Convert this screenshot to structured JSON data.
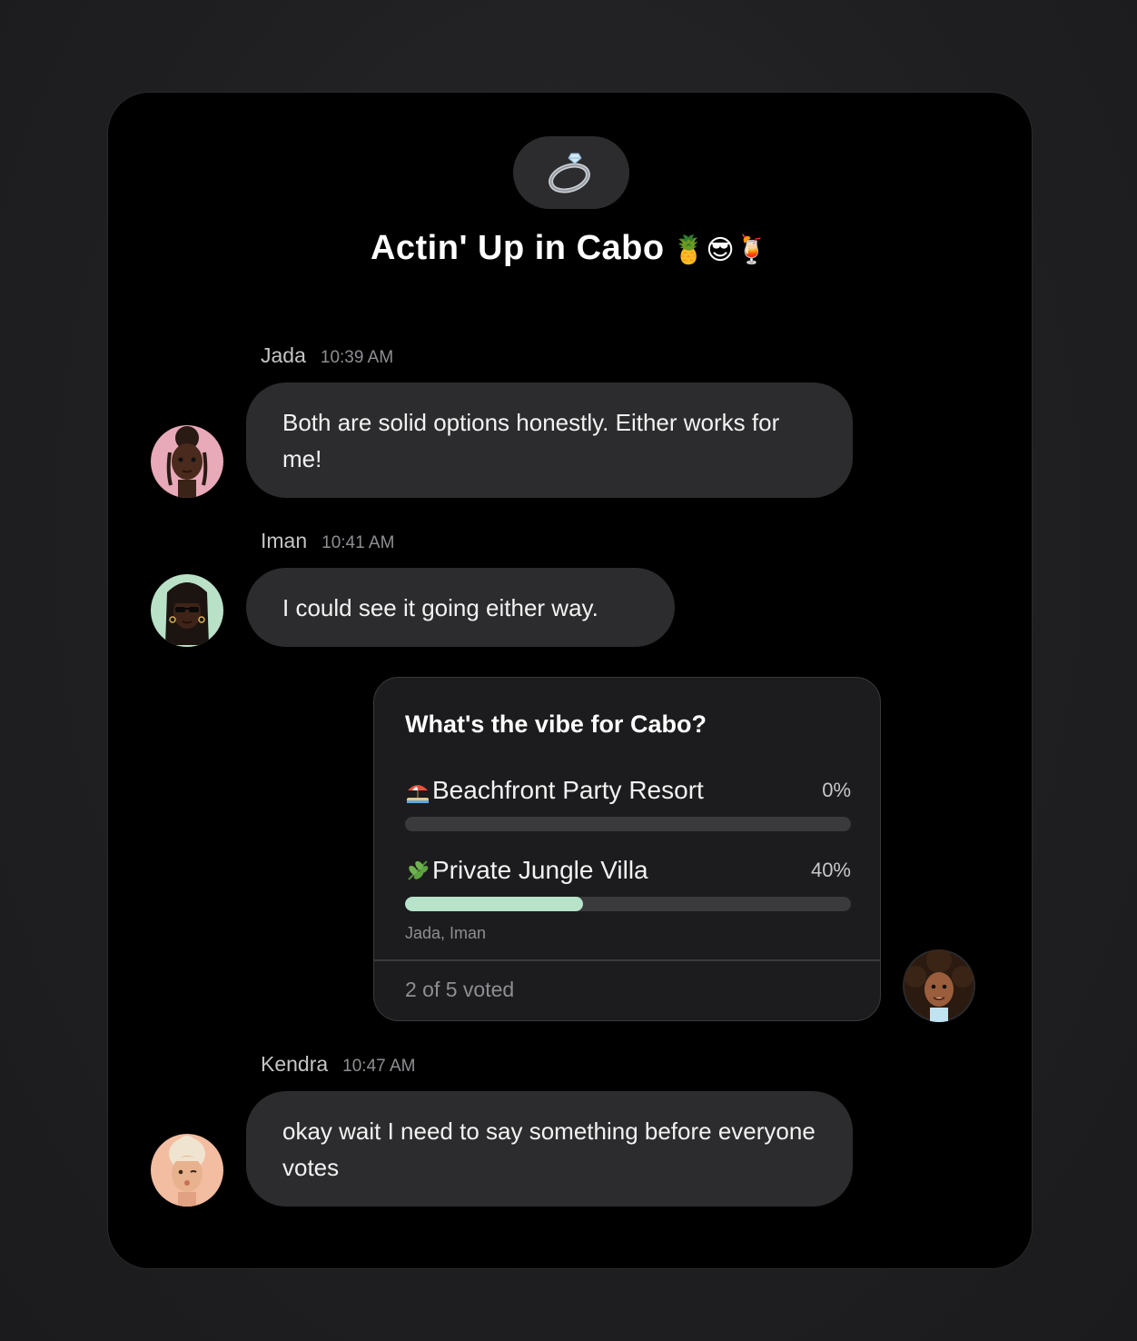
{
  "chat": {
    "group_icon": "ring-icon",
    "title": "Actin' Up in Cabo",
    "title_emojis": "🍍😎🍹"
  },
  "messages": [
    {
      "sender": "Jada",
      "time": "10:39 AM",
      "text": "Both are solid options honestly. Either works for me!",
      "avatar_color": "#e8a9b8"
    },
    {
      "sender": "Iman",
      "time": "10:41 AM",
      "text": "I could see it going either way.",
      "avatar_color": "#b9e1c8"
    },
    {
      "sender": "Kendra",
      "time": "10:47 AM",
      "text": "okay wait I need to say something before everyone votes",
      "avatar_color": "#f3bda1"
    }
  ],
  "poll": {
    "question": "What's the vibe for Cabo?",
    "options": [
      {
        "icon": "beach-umbrella-icon",
        "label": "Beachfront Party Resort",
        "percent_label": "0%",
        "percent": 0,
        "voters": ""
      },
      {
        "icon": "herb-leaf-icon",
        "label": "Private Jungle Villa",
        "percent_label": "40%",
        "percent": 40,
        "voters": "Jada, Iman"
      }
    ],
    "footer": "2 of 5 voted",
    "author_avatar_color": "#2a2a2c",
    "fill_color": "#b6e3c9"
  }
}
